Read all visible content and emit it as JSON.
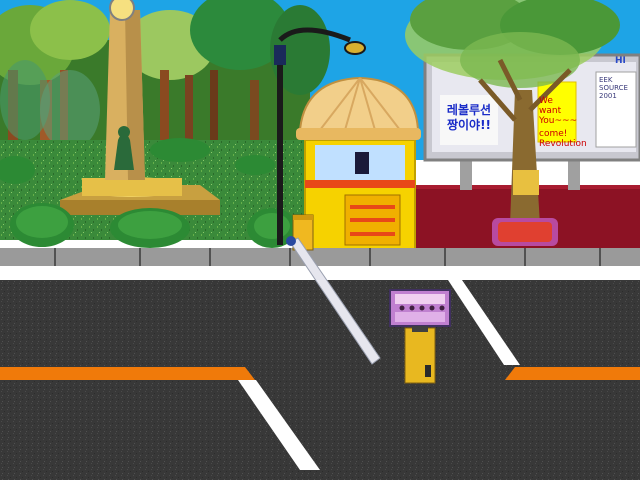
{
  "scene": {
    "colors": {
      "sky": "#1ea4e6",
      "road": "#3a3a3a",
      "lane_orange": "#f07a0a",
      "lane_white": "#ffffff",
      "curb": "#9a9a9a",
      "wall_red": "#8c1224",
      "grass": "#3c8a3c",
      "booth_yellow": "#f6d200",
      "booth_canopy": "#f2cf8a"
    }
  },
  "billboard": {
    "korean_line1": "레볼루션",
    "korean_line2": "짱이야!!",
    "notice_lines": [
      "We want",
      "You~~~",
      "come!",
      "Revolution"
    ],
    "partial_lines": [
      "EEK",
      "SOURCE",
      "2001"
    ],
    "top_fragment": "HI"
  },
  "barrier": {
    "state": "raised"
  },
  "ticket_machine": {
    "slot_count": 5
  }
}
